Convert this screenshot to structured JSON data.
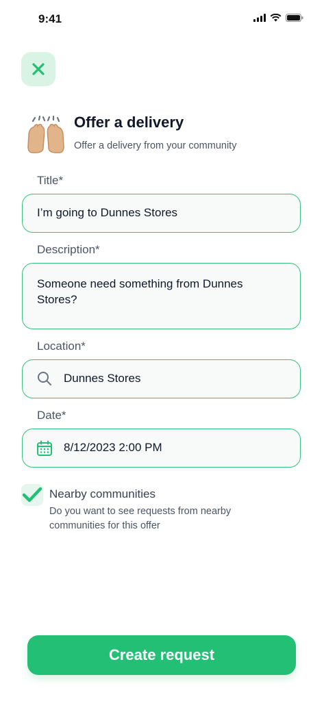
{
  "status_bar": {
    "time": "9:41",
    "icons": [
      "signal-icon",
      "wifi-icon",
      "battery-icon"
    ]
  },
  "header": {
    "close_icon": "close-icon",
    "emoji_icon": "raised-hands-icon",
    "title": "Offer a delivery",
    "subtitle": "Offer a delivery from your community"
  },
  "form": {
    "title": {
      "label": "Title*",
      "value": "I’m going to Dunnes Stores"
    },
    "description": {
      "label": "Description*",
      "value": "Someone need something from Dunnes Stores?"
    },
    "location": {
      "label": "Location*",
      "value": "Dunnes Stores",
      "icon": "search-icon"
    },
    "date": {
      "label": "Date*",
      "value": "8/12/2023 2:00 PM",
      "icon": "calendar-icon"
    }
  },
  "nearby": {
    "checked": true,
    "title": "Nearby communities",
    "description": "Do you want to see requests from nearby communities for this offer"
  },
  "cta_label": "Create request",
  "colors": {
    "accent": "#22bf74",
    "border": "#34c27b",
    "close_bg": "#d9f3e5"
  }
}
